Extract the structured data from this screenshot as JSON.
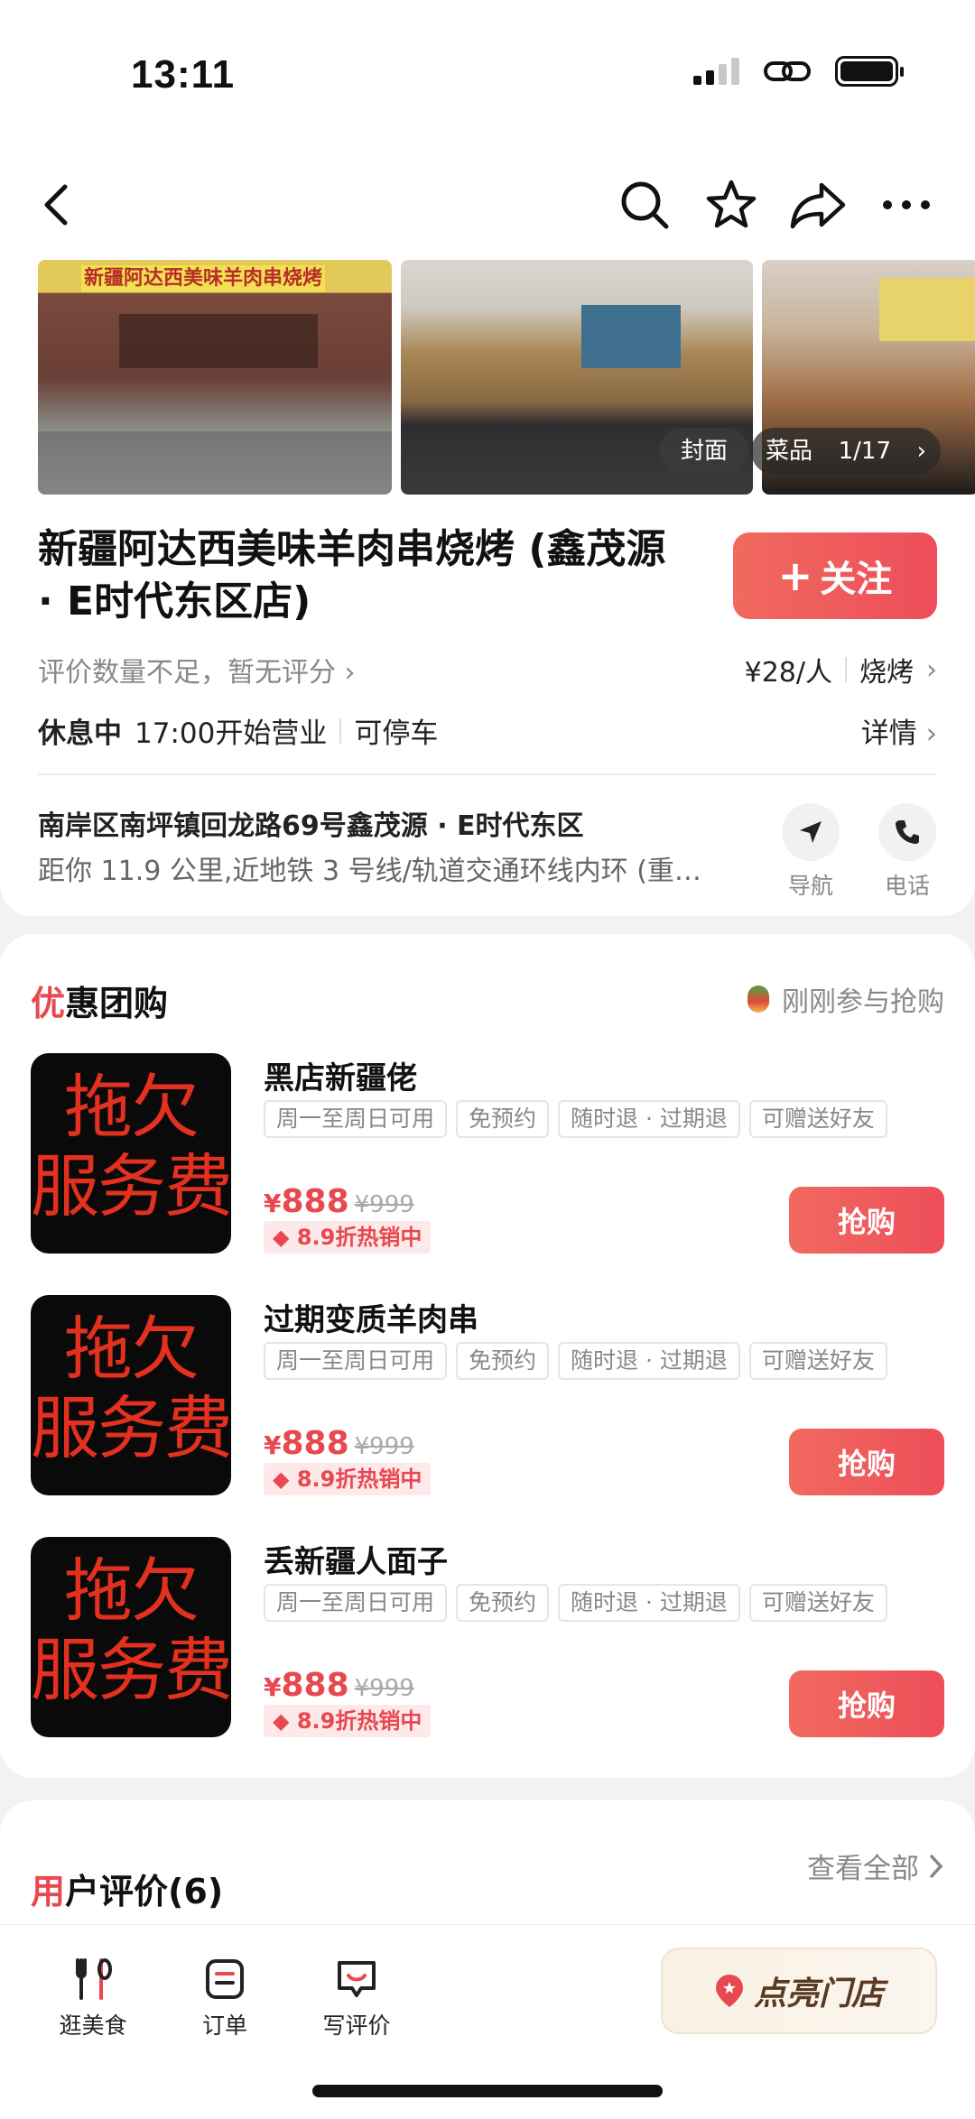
{
  "status": {
    "time": "13:11"
  },
  "photos": {
    "cover_label": "封面",
    "dishes_label": "菜品",
    "count": "1/17",
    "sign_text": "新疆阿达西美味羊肉串烧烤"
  },
  "shop": {
    "name": "新疆阿达西美味羊肉串烧烤 (鑫茂源 · E时代东区店)",
    "follow_label": "关注",
    "rating_text": "评价数量不足，暂无评分",
    "price_per_person": "¥28/人",
    "category": "烧烤",
    "status": "休息中",
    "open_time": "17:00开始营业",
    "parking": "可停车",
    "detail_label": "详情",
    "address": "南岸区南坪镇回龙路69号鑫茂源 · E时代东区",
    "distance": "距你 11.9 公里,近地铁 3 号线/轨道交通环线内环 (重…",
    "nav_label": "导航",
    "phone_label": "电话"
  },
  "deals": {
    "title_mark": "优",
    "title_rest": "惠团购",
    "flash_text": "刚刚参与抢购",
    "items": [
      {
        "title": "黑店新疆佬",
        "thumb_line1": "拖欠",
        "thumb_line2": "服务费",
        "tags": [
          "周一至周日可用",
          "免预约",
          "随时退 · 过期退",
          "可赠送好友"
        ],
        "currency": "¥",
        "price": "888",
        "original": "¥999",
        "promo": "8.9折热销中",
        "buy": "抢购"
      },
      {
        "title": "过期变质羊肉串",
        "thumb_line1": "拖欠",
        "thumb_line2": "服务费",
        "tags": [
          "周一至周日可用",
          "免预约",
          "随时退 · 过期退",
          "可赠送好友"
        ],
        "currency": "¥",
        "price": "888",
        "original": "¥999",
        "promo": "8.9折热销中",
        "buy": "抢购"
      },
      {
        "title": "丢新疆人面子",
        "thumb_line1": "拖欠",
        "thumb_line2": "服务费",
        "tags": [
          "周一至周日可用",
          "免预约",
          "随时退 · 过期退",
          "可赠送好友"
        ],
        "currency": "¥",
        "price": "888",
        "original": "¥999",
        "promo": "8.9折热销中",
        "buy": "抢购"
      }
    ]
  },
  "reviews": {
    "title_mark": "用",
    "title_rest": "户评价(6)",
    "see_all": "查看全部"
  },
  "tabbar": {
    "tabs": [
      {
        "label": "逛美食"
      },
      {
        "label": "订单"
      },
      {
        "label": "写评价"
      }
    ],
    "light_button": "点亮门店"
  },
  "colors": {
    "accent": "#ee4d5a",
    "text": "#111111",
    "muted": "#888888"
  }
}
